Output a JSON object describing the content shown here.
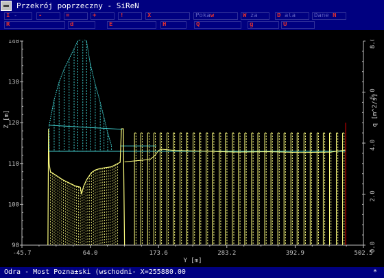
{
  "window": {
    "title": "Przekrój poprzeczny - SiReN"
  },
  "menu": {
    "row1": [
      {
        "label": "I  - ",
        "hotkey": "I"
      },
      {
        "label": "  -  ",
        "hotkey": "-"
      },
      {
        "label": "  =  ",
        "hotkey": "="
      },
      {
        "label": "  +  ",
        "hotkey": "+"
      },
      {
        "label": "  !  ",
        "hotkey": "!"
      },
      {
        "label": "   X ",
        "hotkey": "X"
      },
      {
        "label": " Pokaw ",
        "hotkey": "w"
      },
      {
        "label": "W  za ",
        "hotkey": "W"
      },
      {
        "label": "D  ala ",
        "hotkey": "D"
      },
      {
        "label": " Dane N",
        "hotkey": "N"
      }
    ],
    "row2": [
      {
        "label": "R  ",
        "hotkey": "R"
      },
      {
        "label": "    d ",
        "hotkey": "d"
      },
      {
        "label": "E  ",
        "hotkey": "E"
      },
      {
        "label": "  H ",
        "hotkey": "H"
      },
      {
        "label": "   Q ",
        "hotkey": "Q"
      },
      {
        "label": " g ",
        "hotkey": "g"
      },
      {
        "label": " U  ",
        "hotkey": "U"
      }
    ]
  },
  "chart_data": {
    "type": "line",
    "xlabel": "Y [m]",
    "ylabel_left": "Z [m]",
    "ylabel_right": "q [m^2/s]",
    "xlim": [
      -45.7,
      502.5
    ],
    "ylim_left": [
      90,
      140
    ],
    "ylim_right": [
      0,
      8
    ],
    "x_ticks": [
      "-45.7",
      "64.0",
      "173.6",
      "283.2",
      "392.9",
      "502.5"
    ],
    "y_ticks_left": [
      "90",
      "100",
      "110",
      "120",
      "130",
      "140"
    ],
    "y_ticks_right": [
      "0.0",
      "2.0",
      "4.0",
      "6.0",
      "8.0"
    ],
    "colors": {
      "terrain": "#ffff80",
      "water": "#40c0c0",
      "discharge": "#40d0d0",
      "marker": "#c00000",
      "axis": "#c0c0c0"
    },
    "water_level": 113.0,
    "terrain_profile": [
      [
        -4,
        90
      ],
      [
        -3,
        118.5
      ],
      [
        -2,
        110
      ],
      [
        0,
        108
      ],
      [
        20,
        106
      ],
      [
        40,
        104.5
      ],
      [
        48,
        104.2
      ],
      [
        50,
        102.5
      ],
      [
        53,
        104.3
      ],
      [
        58,
        106
      ],
      [
        66,
        107.8
      ],
      [
        72,
        108.4
      ],
      [
        80,
        108.8
      ],
      [
        98,
        109.2
      ],
      [
        112,
        110.3
      ],
      [
        114,
        118.5
      ],
      [
        117,
        118.5
      ],
      [
        119,
        90
      ]
    ],
    "floodplain_profile": [
      [
        119,
        110.4
      ],
      [
        160,
        111.0
      ],
      [
        168,
        112.0
      ],
      [
        173.6,
        113.2
      ],
      [
        178,
        113.5
      ],
      [
        200,
        113.2
      ],
      [
        250,
        113.0
      ],
      [
        300,
        112.8
      ],
      [
        350,
        112.9
      ],
      [
        400,
        112.7
      ],
      [
        450,
        112.8
      ],
      [
        474,
        113.3
      ]
    ],
    "discharge_profile": [
      [
        -2,
        4.7
      ],
      [
        6,
        5.7
      ],
      [
        14,
        6.4
      ],
      [
        22,
        6.9
      ],
      [
        30,
        7.3
      ],
      [
        38,
        7.7
      ],
      [
        44,
        8.0
      ],
      [
        52,
        8.1
      ],
      [
        58,
        8.0
      ],
      [
        64,
        7.1
      ],
      [
        72,
        6.3
      ],
      [
        80,
        5.6
      ],
      [
        86,
        5.0
      ],
      [
        92,
        4.4
      ],
      [
        98,
        3.9
      ]
    ],
    "piers": [
      135,
      145,
      156,
      166,
      176,
      187,
      197,
      208,
      218,
      229,
      239,
      250,
      260,
      271,
      281,
      292,
      302,
      312,
      323,
      333,
      344,
      354,
      365,
      375,
      386,
      396,
      407,
      417,
      428,
      438,
      448,
      459,
      469
    ],
    "pier_top": 117.5,
    "marker_x": 474,
    "marker_top": 120
  },
  "status": {
    "text": "Odra - Most Pozna±ski (wschodni- X=255880.00",
    "indicator": "*"
  }
}
